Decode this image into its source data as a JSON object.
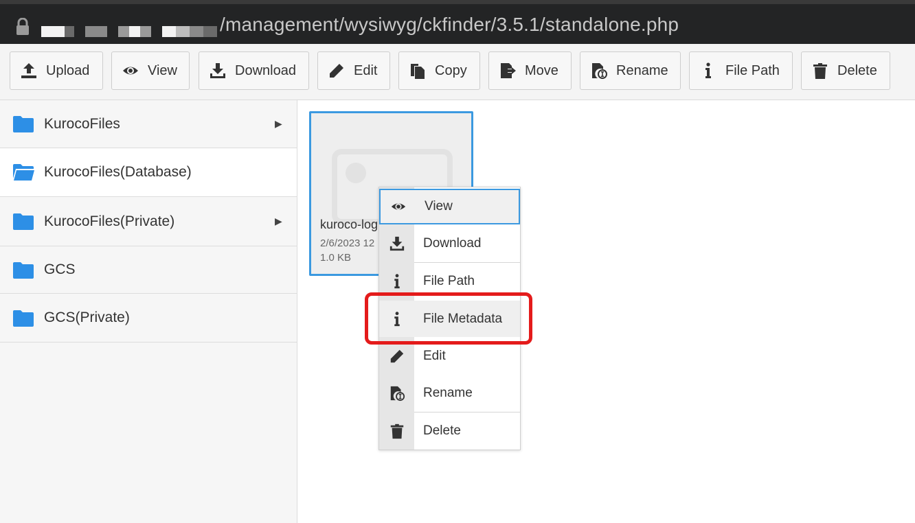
{
  "url": {
    "path": "/management/wysiwyg/ckfinder/3.5.1/standalone.php"
  },
  "toolbar": {
    "buttons": [
      {
        "label": "Upload",
        "icon": "upload-icon"
      },
      {
        "label": "View",
        "icon": "eye-icon"
      },
      {
        "label": "Download",
        "icon": "download-icon"
      },
      {
        "label": "Edit",
        "icon": "pencil-icon"
      },
      {
        "label": "Copy",
        "icon": "copy-icon"
      },
      {
        "label": "Move",
        "icon": "move-icon"
      },
      {
        "label": "Rename",
        "icon": "rename-icon"
      },
      {
        "label": "File Path",
        "icon": "info-icon"
      },
      {
        "label": "Delete",
        "icon": "trash-icon"
      }
    ]
  },
  "sidebar": {
    "folders": [
      {
        "label": "KurocoFiles",
        "expandable": true
      },
      {
        "label": "KurocoFiles(Database)",
        "expandable": false,
        "active": true
      },
      {
        "label": "KurocoFiles(Private)",
        "expandable": true
      },
      {
        "label": "GCS",
        "expandable": false
      },
      {
        "label": "GCS(Private)",
        "expandable": false
      }
    ],
    "arrow_glyph": "▶"
  },
  "file": {
    "name": "kuroco-log",
    "date": "2/6/2023 12",
    "size": "1.0 KB"
  },
  "context_menu": {
    "items": [
      {
        "label": "View",
        "icon": "eye-icon"
      },
      {
        "label": "Download",
        "icon": "download-icon"
      },
      {
        "label": "File Path",
        "icon": "info-icon"
      },
      {
        "label": "File Metadata",
        "icon": "info-icon"
      },
      {
        "label": "Edit",
        "icon": "pencil-icon"
      },
      {
        "label": "Rename",
        "icon": "rename-icon"
      },
      {
        "label": "Delete",
        "icon": "trash-icon"
      }
    ]
  },
  "colors": {
    "accent": "#3b99e0",
    "folder": "#2d8fe6",
    "highlight": "#e41b1b",
    "urlbar": "#232425"
  }
}
